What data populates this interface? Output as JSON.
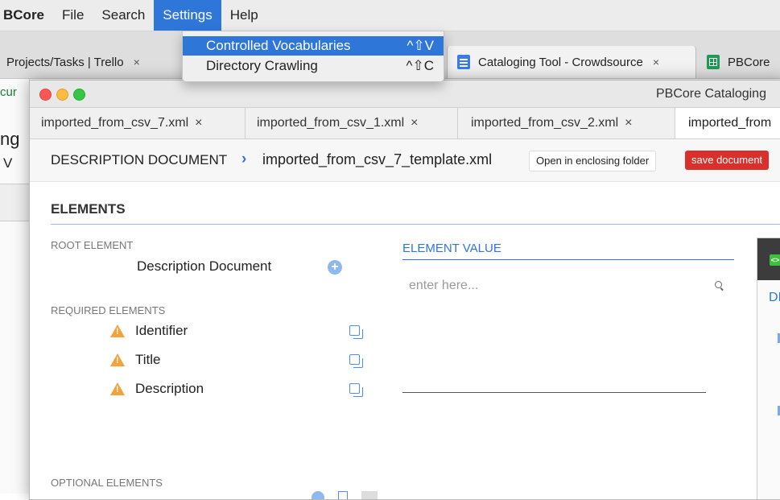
{
  "menubar": {
    "app_name": "BCore",
    "items": [
      "File",
      "Search",
      "Settings",
      "Help"
    ],
    "active_item": "Settings"
  },
  "settings_menu": {
    "items": [
      {
        "label": "Controlled Vocabularies",
        "shortcut": "^⇧V"
      },
      {
        "label": "Directory Crawling",
        "shortcut": "^⇧C"
      }
    ]
  },
  "browser": {
    "tabs": [
      {
        "label": "Projects/Tasks | Trello",
        "close": "×"
      },
      {
        "label": "Cataloging Tool - Crowdsource",
        "close": "×"
      },
      {
        "label": "PBCore"
      }
    ],
    "left_fragments": [
      "cur",
      "ng",
      "V"
    ]
  },
  "app": {
    "window_title": "PBCore Cataloging",
    "doc_tabs": [
      {
        "label": "imported_from_csv_7.xml",
        "close": "×"
      },
      {
        "label": "imported_from_csv_1.xml",
        "close": "×"
      },
      {
        "label": "imported_from_csv_2.xml",
        "close": "×"
      },
      {
        "label": "imported_from"
      }
    ],
    "breadcrumb": {
      "root": "DESCRIPTION DOCUMENT",
      "separator": "›",
      "file": "imported_from_csv_7_template.xml"
    },
    "open_folder_label": "Open in enclosing folder",
    "save_label": "save document",
    "elements": {
      "heading": "ELEMENTS",
      "root_section": "ROOT ELEMENT",
      "root_element": "Description Document",
      "required_section": "REQUIRED ELEMENTS",
      "required": [
        "Identifier",
        "Title",
        "Description"
      ],
      "optional_section": "OPTIONAL ELEMENTS"
    },
    "element_value": {
      "label": "ELEMENT VALUE",
      "placeholder": "enter here..."
    },
    "right_panel": {
      "label_fragment": "DI"
    }
  },
  "colors": {
    "accent": "#2f76d9",
    "save": "#d9302c",
    "warning": "#f4a23a"
  }
}
